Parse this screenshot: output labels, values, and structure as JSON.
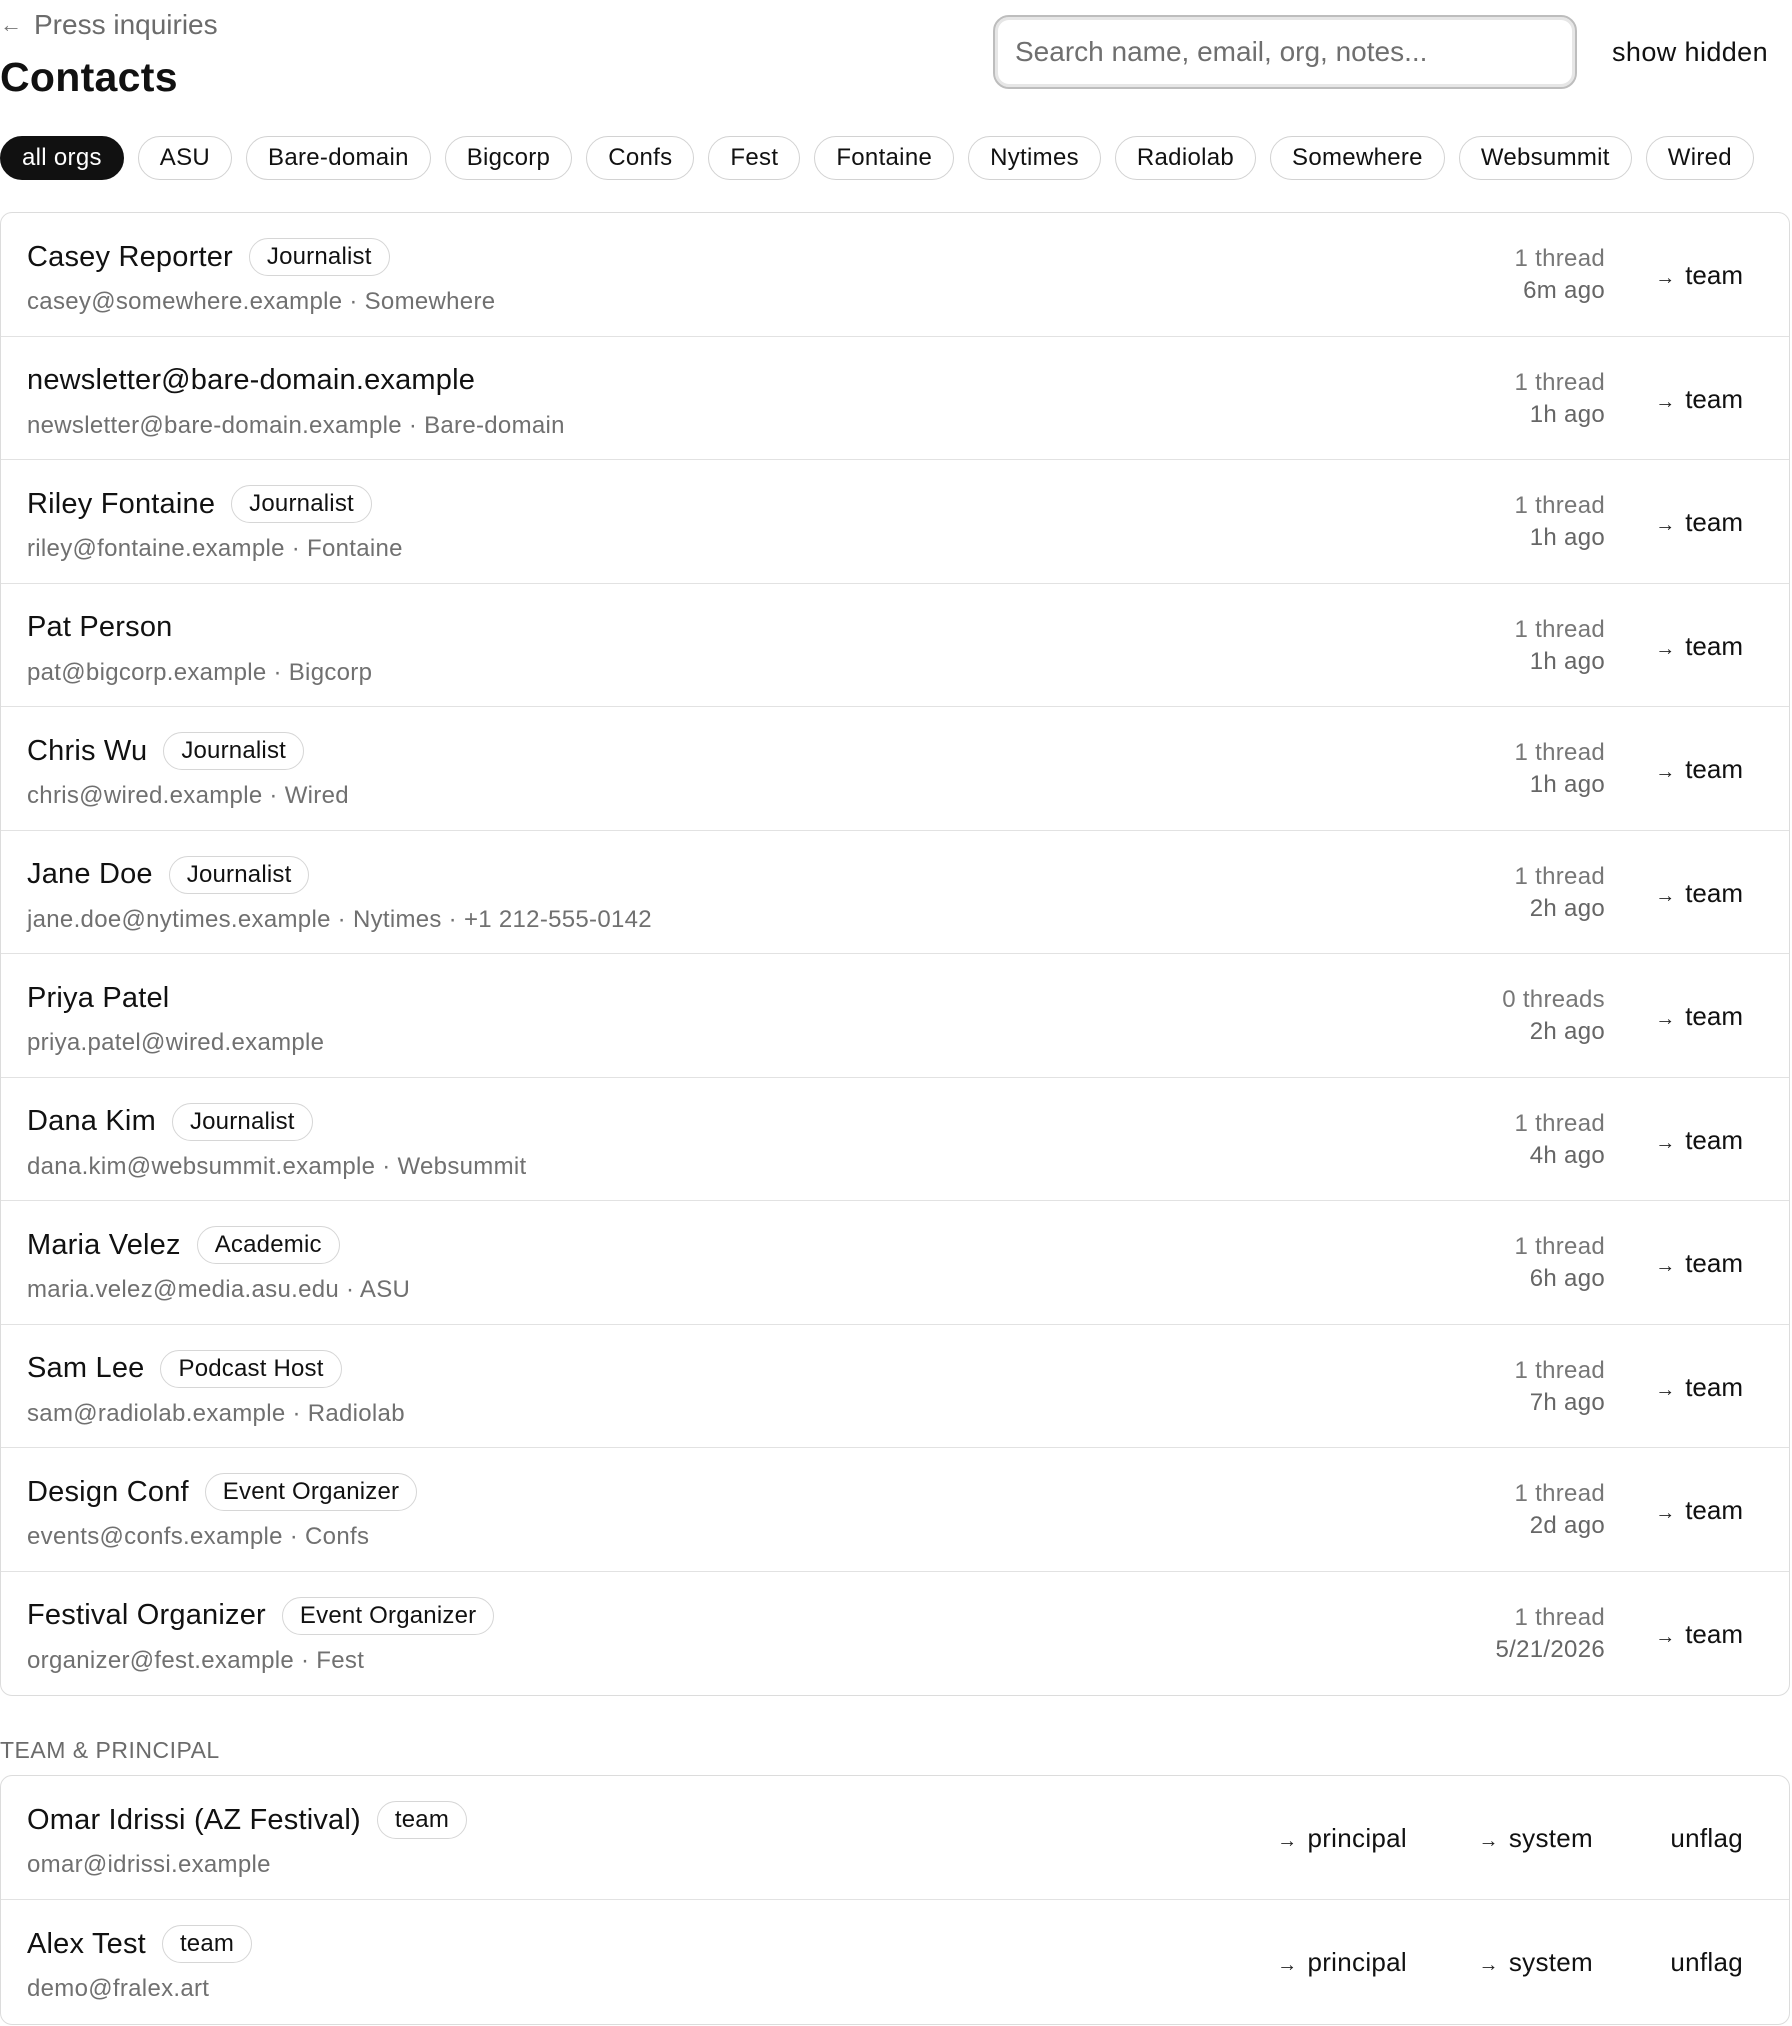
{
  "header": {
    "back_label": "Press inquiries",
    "back_icon": "←",
    "title": "Contacts",
    "search_placeholder": "Search name, email, org, notes...",
    "search_value": "",
    "show_hidden_label": "show hidden"
  },
  "filters": [
    {
      "label": "all orgs",
      "active": true
    },
    {
      "label": "ASU"
    },
    {
      "label": "Bare-domain"
    },
    {
      "label": "Bigcorp"
    },
    {
      "label": "Confs"
    },
    {
      "label": "Fest"
    },
    {
      "label": "Fontaine"
    },
    {
      "label": "Nytimes"
    },
    {
      "label": "Radiolab"
    },
    {
      "label": "Somewhere"
    },
    {
      "label": "Websummit"
    },
    {
      "label": "Wired"
    }
  ],
  "contacts": [
    {
      "name": "Casey Reporter",
      "tag": "Journalist",
      "subtitle": "casey@somewhere.example · Somewhere",
      "threads": "1 thread",
      "when": "6m ago",
      "action": "team"
    },
    {
      "name": "newsletter@bare-domain.example",
      "tag": "",
      "subtitle": "newsletter@bare-domain.example · Bare-domain",
      "threads": "1 thread",
      "when": "1h ago",
      "action": "team"
    },
    {
      "name": "Riley Fontaine",
      "tag": "Journalist",
      "subtitle": "riley@fontaine.example · Fontaine",
      "threads": "1 thread",
      "when": "1h ago",
      "action": "team"
    },
    {
      "name": "Pat Person",
      "tag": "",
      "subtitle": "pat@bigcorp.example · Bigcorp",
      "threads": "1 thread",
      "when": "1h ago",
      "action": "team"
    },
    {
      "name": "Chris Wu",
      "tag": "Journalist",
      "subtitle": "chris@wired.example · Wired",
      "threads": "1 thread",
      "when": "1h ago",
      "action": "team"
    },
    {
      "name": "Jane Doe",
      "tag": "Journalist",
      "subtitle": "jane.doe@nytimes.example · Nytimes · +1 212-555-0142",
      "threads": "1 thread",
      "when": "2h ago",
      "action": "team"
    },
    {
      "name": "Priya Patel",
      "tag": "",
      "subtitle": "priya.patel@wired.example",
      "threads": "0 threads",
      "when": "2h ago",
      "action": "team"
    },
    {
      "name": "Dana Kim",
      "tag": "Journalist",
      "subtitle": "dana.kim@websummit.example · Websummit",
      "threads": "1 thread",
      "when": "4h ago",
      "action": "team"
    },
    {
      "name": "Maria Velez",
      "tag": "Academic",
      "subtitle": "maria.velez@media.asu.edu · ASU",
      "threads": "1 thread",
      "when": "6h ago",
      "action": "team"
    },
    {
      "name": "Sam Lee",
      "tag": "Podcast Host",
      "subtitle": "sam@radiolab.example · Radiolab",
      "threads": "1 thread",
      "when": "7h ago",
      "action": "team"
    },
    {
      "name": "Design Conf",
      "tag": "Event Organizer",
      "subtitle": "events@confs.example · Confs",
      "threads": "1 thread",
      "when": "2d ago",
      "action": "team"
    },
    {
      "name": "Festival Organizer",
      "tag": "Event Organizer",
      "subtitle": "organizer@fest.example · Fest",
      "threads": "1 thread",
      "when": "5/21/2026",
      "action": "team"
    }
  ],
  "team_section": {
    "label": "TEAM & PRINCIPAL",
    "members": [
      {
        "name": "Omar Idrissi (AZ Festival)",
        "tag": "team",
        "subtitle": "omar@idrissi.example",
        "action_principal": "principal",
        "action_system": "system",
        "action_unflag": "unflag"
      },
      {
        "name": "Alex Test",
        "tag": "team",
        "subtitle": "demo@fralex.art",
        "action_principal": "principal",
        "action_system": "system",
        "action_unflag": "unflag"
      }
    ]
  },
  "icons": {
    "arrow": "→"
  },
  "colors": {
    "active_chip_bg": "#111111",
    "border": "#dcdcdc",
    "muted_text": "#707070"
  }
}
